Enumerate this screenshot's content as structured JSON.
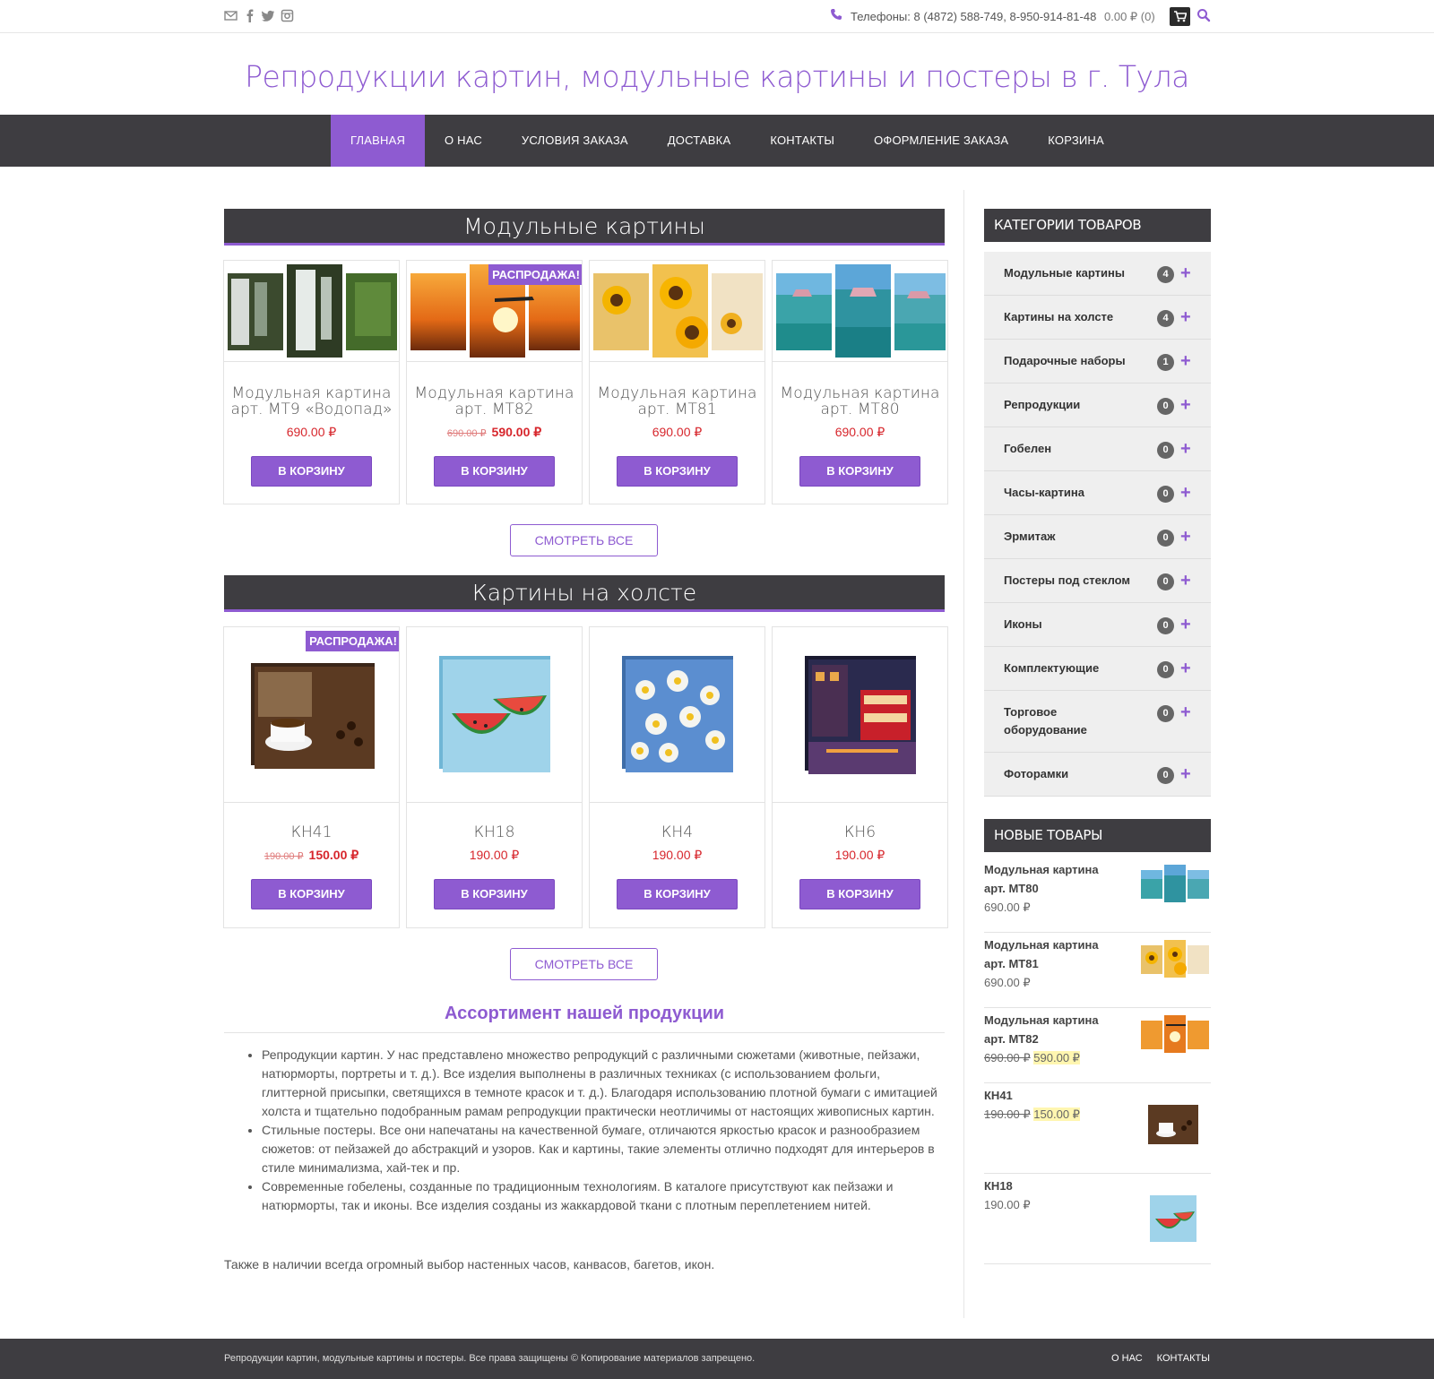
{
  "topbar": {
    "social": [
      "mail-icon",
      "facebook-icon",
      "twitter-icon",
      "instagram-icon"
    ],
    "phones": "Телефоны: 8 (4872) 588-749, 8-950-914-81-48",
    "cart_total": "0.00 ₽ (0)"
  },
  "site": {
    "title": "Репродукции картин, модульные картины и постеры в г. Тула"
  },
  "nav": [
    "Главная",
    "О нас",
    "Условия заказа",
    "Доставка",
    "Контакты",
    "Оформление заказа",
    "Корзина"
  ],
  "sections": {
    "modular": {
      "title": "Модульные картины",
      "products": [
        {
          "title": "Модульная картина арт. МТ9 «Водопад»",
          "price": "690.00 ₽",
          "old_price": "",
          "sale": false
        },
        {
          "title": "Модульная картина арт. МТ82",
          "price": "590.00 ₽",
          "old_price": "690.00 ₽",
          "sale": true
        },
        {
          "title": "Модульная картина арт. МТ81",
          "price": "690.00 ₽",
          "old_price": "",
          "sale": false
        },
        {
          "title": "Модульная картина арт. МТ80",
          "price": "690.00 ₽",
          "old_price": "",
          "sale": false
        }
      ]
    },
    "canvas": {
      "title": "Картины на холсте",
      "products": [
        {
          "title": "КН41",
          "price": "150.00 ₽",
          "old_price": "190.00 ₽",
          "sale": true
        },
        {
          "title": "КН18",
          "price": "190.00 ₽",
          "old_price": "",
          "sale": false
        },
        {
          "title": "КН4",
          "price": "190.00 ₽",
          "old_price": "",
          "sale": false
        },
        {
          "title": "КН6",
          "price": "190.00 ₽",
          "old_price": "",
          "sale": false
        }
      ]
    },
    "buy_label": "В КОРЗИНУ",
    "sale_label": "РАСПРОДАЖА!",
    "more_label": "СМОТРЕТЬ ВСЕ"
  },
  "assortment": {
    "title": "Ассортимент нашей продукции",
    "items": [
      "Репродукции картин. У нас представлено множество репродукций с различными сюжетами (животные, пейзажи, натюрморты, портреты и т. д.). Все изделия выполнены в различных техниках (с использованием фольги, глиттерной присыпки, светящихся в темноте красок и т. д.). Благодаря использованию плотной бумаги с имитацией холста и тщательно подобранным рамам репродукции практически неотличимы от настоящих живописных картин.",
      "Стильные постеры. Все они напечатаны на качественной бумаге, отличаются яркостью красок и разнообразием сюжетов: от пейзажей до абстракций и узоров. Как и картины, такие элементы отлично подходят для интерьеров в стиле минимализма, хай-тек и пр.",
      "Современные гобелены, созданные по традиционным технологиям. В каталоге присутствуют как пейзажи и натюрморты, так и иконы. Все изделия созданы из жаккардовой ткани с плотным переплетением нитей."
    ],
    "footer_text": "Также в наличии всегда огромный выбор настенных часов, канвасов, багетов, икон."
  },
  "sidebar": {
    "categories_title": "Категории товаров",
    "categories": [
      {
        "name": "Модульные картины",
        "count": "4"
      },
      {
        "name": "Картины на холсте",
        "count": "4"
      },
      {
        "name": "Подарочные наборы",
        "count": "1"
      },
      {
        "name": "Репродукции",
        "count": "0"
      },
      {
        "name": "Гобелен",
        "count": "0"
      },
      {
        "name": "Часы-картина",
        "count": "0"
      },
      {
        "name": "Эрмитаж",
        "count": "0"
      },
      {
        "name": "Постеры под стеклом",
        "count": "0"
      },
      {
        "name": "Иконы",
        "count": "0"
      },
      {
        "name": "Комплектующие",
        "count": "0"
      },
      {
        "name": "Торговое оборудование",
        "count": "0"
      },
      {
        "name": "Фоторамки",
        "count": "0"
      }
    ],
    "new_title": "Новые товары",
    "new_items": [
      {
        "name": "Модульная картина арт. МТ80",
        "price": "690.00 ₽",
        "old_price": ""
      },
      {
        "name": "Модульная картина арт. МТ81",
        "price": "690.00 ₽",
        "old_price": ""
      },
      {
        "name": "Модульная картина арт. МТ82",
        "price": "590.00 ₽",
        "old_price": "690.00 ₽"
      },
      {
        "name": "КН41",
        "price": "150.00 ₽",
        "old_price": "190.00 ₽"
      },
      {
        "name": "КН18",
        "price": "190.00 ₽",
        "old_price": ""
      }
    ]
  },
  "footer": {
    "copyright": "Репродукции картин, модульные картины и постеры. Все права защищены © Копирование материалов запрещено.",
    "links": [
      "О нас",
      "Контакты"
    ]
  },
  "colors": {
    "accent": "#8e5bd1",
    "dark": "#3e3d41",
    "price": "#d7262c"
  }
}
